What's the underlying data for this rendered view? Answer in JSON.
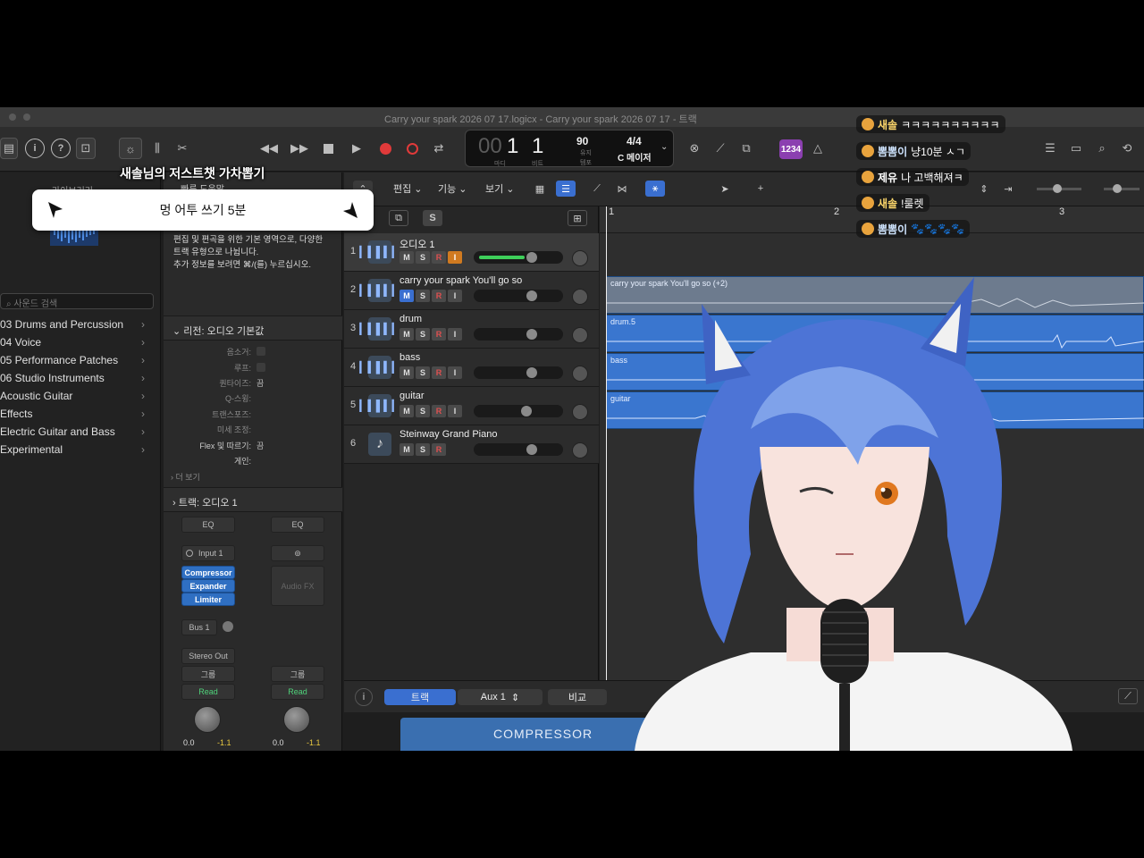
{
  "window": {
    "title": "Carry your spark 2026 07 17.logicx - Carry your spark 2026 07 17 - 트랙"
  },
  "lcd": {
    "bar": "001",
    "beat": "1",
    "tempo": "90",
    "tempo_label_top": "유지",
    "tempo_label_bottom": "템포",
    "signature": "4/4",
    "key": "C 메이저",
    "bar_label": "마디",
    "beat_label": "비트",
    "cpu_badge": "1234"
  },
  "library": {
    "title": "라이브러리",
    "search_placeholder": "사운드 검색",
    "items": [
      "03 Drums and Percussion",
      "04 Voice",
      "05 Performance Patches",
      "06 Studio Instruments",
      "Acoustic Guitar",
      "Effects",
      "Electric Guitar and Bass",
      "Experimental"
    ]
  },
  "inspector": {
    "help_title": "빠른 도움말",
    "help_text_1": "편집 및 편곡을 위한 기본 영역으로, 다양한",
    "help_text_2": "트랙 유형으로 나뉩니다.",
    "help_text_3": "추가 정보를 보려면 ⌘/(를) 누르십시오.",
    "region_header": "리전: 오디오 기본값",
    "rows": [
      {
        "k": "음소거:",
        "v": ""
      },
      {
        "k": "루프:",
        "v": ""
      },
      {
        "k": "퀀타이즈:",
        "v": "끔"
      },
      {
        "k": "Q-스윙:",
        "v": ""
      },
      {
        "k": "트랜스포즈:",
        "v": ""
      },
      {
        "k": "미세 조정:",
        "v": ""
      },
      {
        "k": "Flex 및 따르기:",
        "v": "끔"
      },
      {
        "k": "게인:",
        "v": ""
      }
    ],
    "more": "더 보기",
    "track_header": "트랙: 오디오 1",
    "strip_left": {
      "eq": "EQ",
      "input": "Input 1",
      "plugins": [
        "Compressor",
        "Expander",
        "Limiter"
      ],
      "send": "Bus 1",
      "output": "Stereo Out",
      "group": "그룹",
      "automation": "Read",
      "vol": "0.0",
      "peak": "-1.1"
    },
    "strip_right": {
      "eq": "EQ",
      "audio_fx": "Audio FX",
      "group": "그룹",
      "automation": "Read",
      "vol": "0.0",
      "peak": "-1.1"
    }
  },
  "toolbar": {
    "edit": "편집",
    "function": "기능",
    "view": "보기",
    "solo_btn": "S"
  },
  "tracks": [
    {
      "num": "1",
      "name": "오디오 1",
      "selected": true,
      "buttons": [
        "M",
        "S",
        "R",
        "I"
      ],
      "meter": 0.58,
      "fader": 0.65
    },
    {
      "num": "2",
      "name": "carry your spark You'll go so",
      "selected": false,
      "buttons": [
        "M",
        "S",
        "R",
        "I"
      ],
      "meter": 0,
      "fader": 0.65
    },
    {
      "num": "3",
      "name": "drum",
      "selected": false,
      "buttons": [
        "M",
        "S",
        "R",
        "I"
      ],
      "meter": 0,
      "fader": 0.65
    },
    {
      "num": "4",
      "name": "bass",
      "selected": false,
      "buttons": [
        "M",
        "S",
        "R",
        "I"
      ],
      "meter": 0,
      "fader": 0.65
    },
    {
      "num": "5",
      "name": "guitar",
      "selected": false,
      "buttons": [
        "M",
        "S",
        "R",
        "I"
      ],
      "meter": 0,
      "fader": 0.59
    },
    {
      "num": "6",
      "name": "Steinway Grand Piano",
      "selected": false,
      "buttons": [
        "M",
        "S",
        "R"
      ],
      "meter": 0,
      "fader": 0.65
    }
  ],
  "ruler": [
    "1",
    "2",
    "3"
  ],
  "regions": [
    {
      "name": "carry your spark You'll go so (+2)",
      "style": "grey"
    },
    {
      "name": "drum.5",
      "style": "blue"
    },
    {
      "name": "bass",
      "style": "blue"
    },
    {
      "name": "guitar",
      "style": "blue"
    }
  ],
  "bottombar": {
    "track_tab": "트랙",
    "aux": "Aux 1",
    "compare": "비교",
    "plugin_name": "COMPRESSOR"
  },
  "gacha": {
    "title": "새솔님의 저스트챗 가차뽑기",
    "result": "멍 어투 쓰기 5분"
  },
  "chat": [
    {
      "nick": "새솔",
      "text": "ㅋㅋㅋㅋㅋㅋㅋㅋㅋㅋ",
      "color": "#ffd86b"
    },
    {
      "nick": "뽐뽐이",
      "text": "냥10분 ㅅㄱ",
      "color": "#cfe4ff"
    },
    {
      "nick": "제유",
      "text": "나 고백해져ㅋ",
      "color": "#ffffff"
    },
    {
      "nick": "새솔",
      "text": "!룰렛",
      "color": "#ffd86b"
    },
    {
      "nick": "뽐뽐이",
      "text": "🐾🐾🐾🐾",
      "color": "#cfe4ff"
    }
  ],
  "colors": {
    "accent": "#3a6fd0",
    "region_blue": "#3a76cf",
    "meter_green": "#3ecf5a",
    "record_red": "#e03a3a"
  }
}
